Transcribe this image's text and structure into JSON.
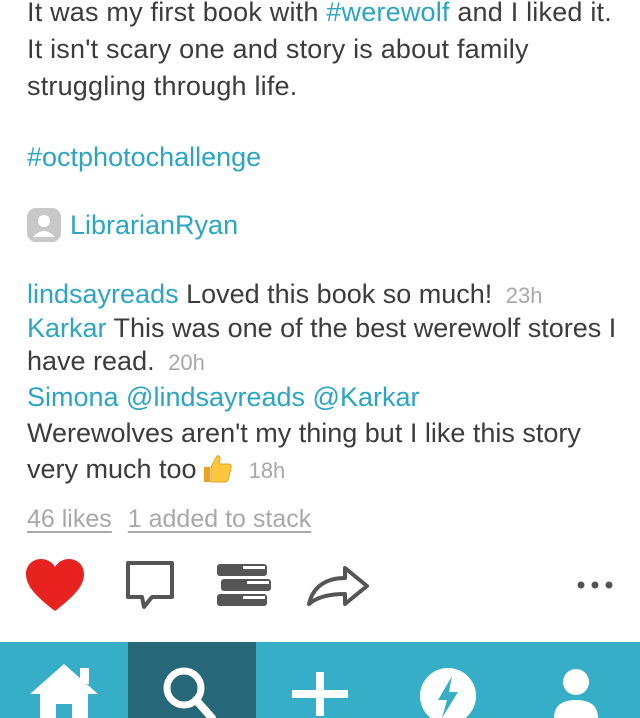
{
  "post": {
    "caption_part1": "It was my first book with ",
    "caption_tag": "#werewolf",
    "caption_part2": " and I liked it. It isn't scary one and story is about family struggling through life.",
    "challenge_tag": "#octphotochallenge",
    "tagged_user": "LibrarianRyan"
  },
  "comments": [
    {
      "user": "lindsayreads",
      "text": " Loved this book so much! ",
      "time": "23h"
    },
    {
      "user": "Karkar",
      "text": " This was one of the best werewolf stores I have read. ",
      "time": "20h"
    },
    {
      "user": "Simona @lindsayreads @Karkar",
      "text": "Werewolves aren't my thing but I like this story very much too",
      "time": "18h"
    }
  ],
  "stats": {
    "likes": "46 likes",
    "stack": "1 added to stack"
  },
  "actions": {
    "like_icon": "heart-icon",
    "comment_icon": "comment-icon",
    "stack_icon": "stack-icon",
    "share_icon": "share-icon",
    "more_icon": "more-icon",
    "like_color": "#e8231f"
  },
  "tabbar": {
    "tabs": [
      "home-icon",
      "search-icon",
      "add-icon",
      "activity-icon",
      "profile-icon"
    ],
    "active_tab": "search-icon",
    "bg_color": "#37aec8",
    "active_color": "#26677a"
  }
}
